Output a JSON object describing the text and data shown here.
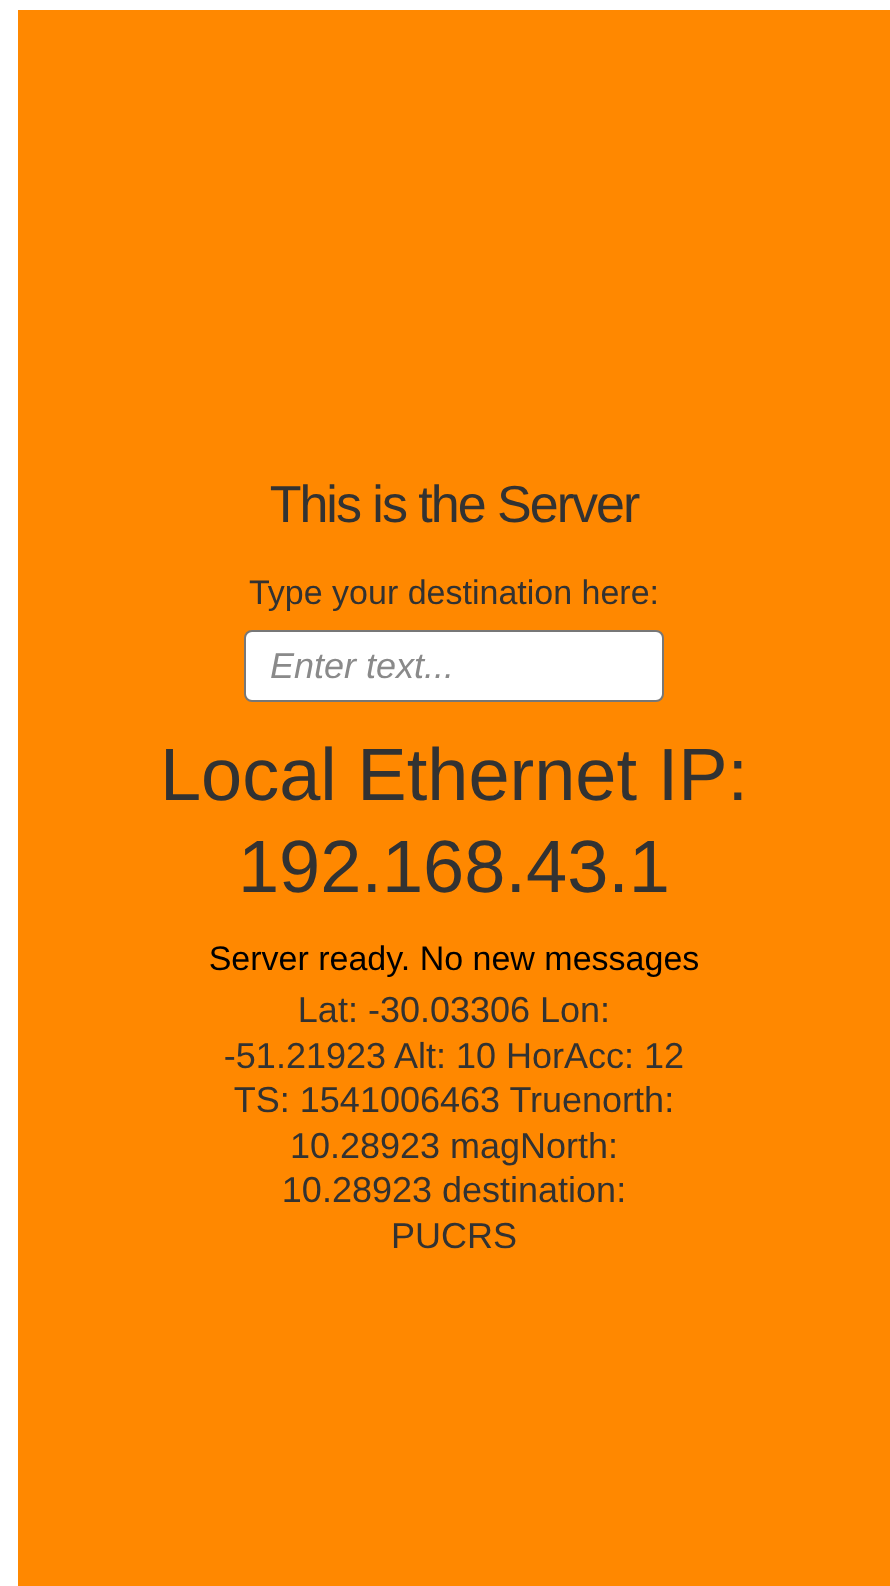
{
  "title": "This is the Server",
  "destination": {
    "label": "Type your destination here:",
    "placeholder": "Enter text..."
  },
  "ip": {
    "label": "Local Ethernet IP:",
    "value": "192.168.43.1"
  },
  "status": "Server ready. No new messages",
  "location": "Lat: -30.03306 Lon: -51.21923 Alt: 10 HorAcc: 12 TS: 1541006463 Truenorth: 10.28923 magNorth: 10.28923 destination: PUCRS"
}
